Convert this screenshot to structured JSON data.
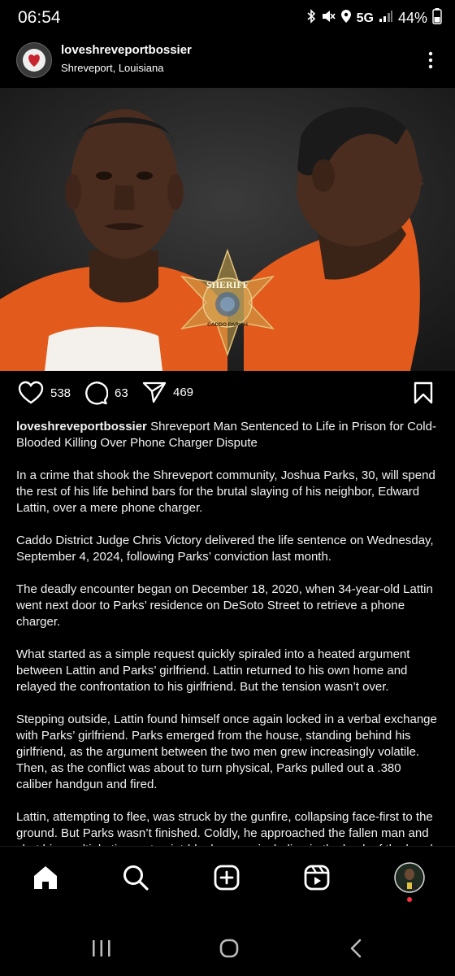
{
  "status_bar": {
    "time": "06:54",
    "network": "5G",
    "battery": "44%",
    "icons": [
      "bluetooth-icon",
      "mute-icon",
      "location-icon",
      "signal-icon",
      "battery-icon"
    ]
  },
  "post": {
    "username": "loveshreveportbossier",
    "location": "Shreveport, Louisiana",
    "image_badge": {
      "top": "SHERIFF",
      "bottom": "CADDO PARISH"
    },
    "likes": "538",
    "comments": "63",
    "shares": "469",
    "caption_title": "Shreveport Man Sentenced to Life in Prison for Cold-Blooded Killing Over Phone Charger Dispute",
    "paragraphs": [
      "In a crime that shook the Shreveport community, Joshua Parks, 30, will spend the rest of his life behind bars for the brutal slaying of his neighbor, Edward Lattin, over a mere phone charger.",
      "Caddo District Judge Chris Victory delivered the life sentence on Wednesday, September 4, 2024, following Parks’ conviction last month.",
      "The deadly encounter began on December 18, 2020, when 34-year-old Lattin went next door to Parks’ residence on DeSoto Street to retrieve a phone charger.",
      "What started as a simple request quickly spiraled into a heated argument between Lattin and Parks’ girlfriend. Lattin returned to his own home and relayed the confrontation to his girlfriend. But the tension wasn’t over.",
      "Stepping outside, Lattin found himself once again locked in a verbal exchange with Parks’ girlfriend. Parks emerged from the house, standing behind his girlfriend, as the argument between the two men grew increasingly volatile. Then, as the conflict was about to turn physical, Parks pulled out a .380 caliber handgun and fired.",
      "Lattin, attempting to flee, was struck by the gunfire, collapsing face-first to the ground. But Parks wasn’t finished. Coldly, he approached the fallen man and shot him multiple times at point-blank range, including in the back of the head."
    ]
  },
  "colors": {
    "background": "#000000",
    "text": "#f5f5f5",
    "badge_gold": "#c9a24a",
    "jumpsuit": "#e65f1c"
  }
}
